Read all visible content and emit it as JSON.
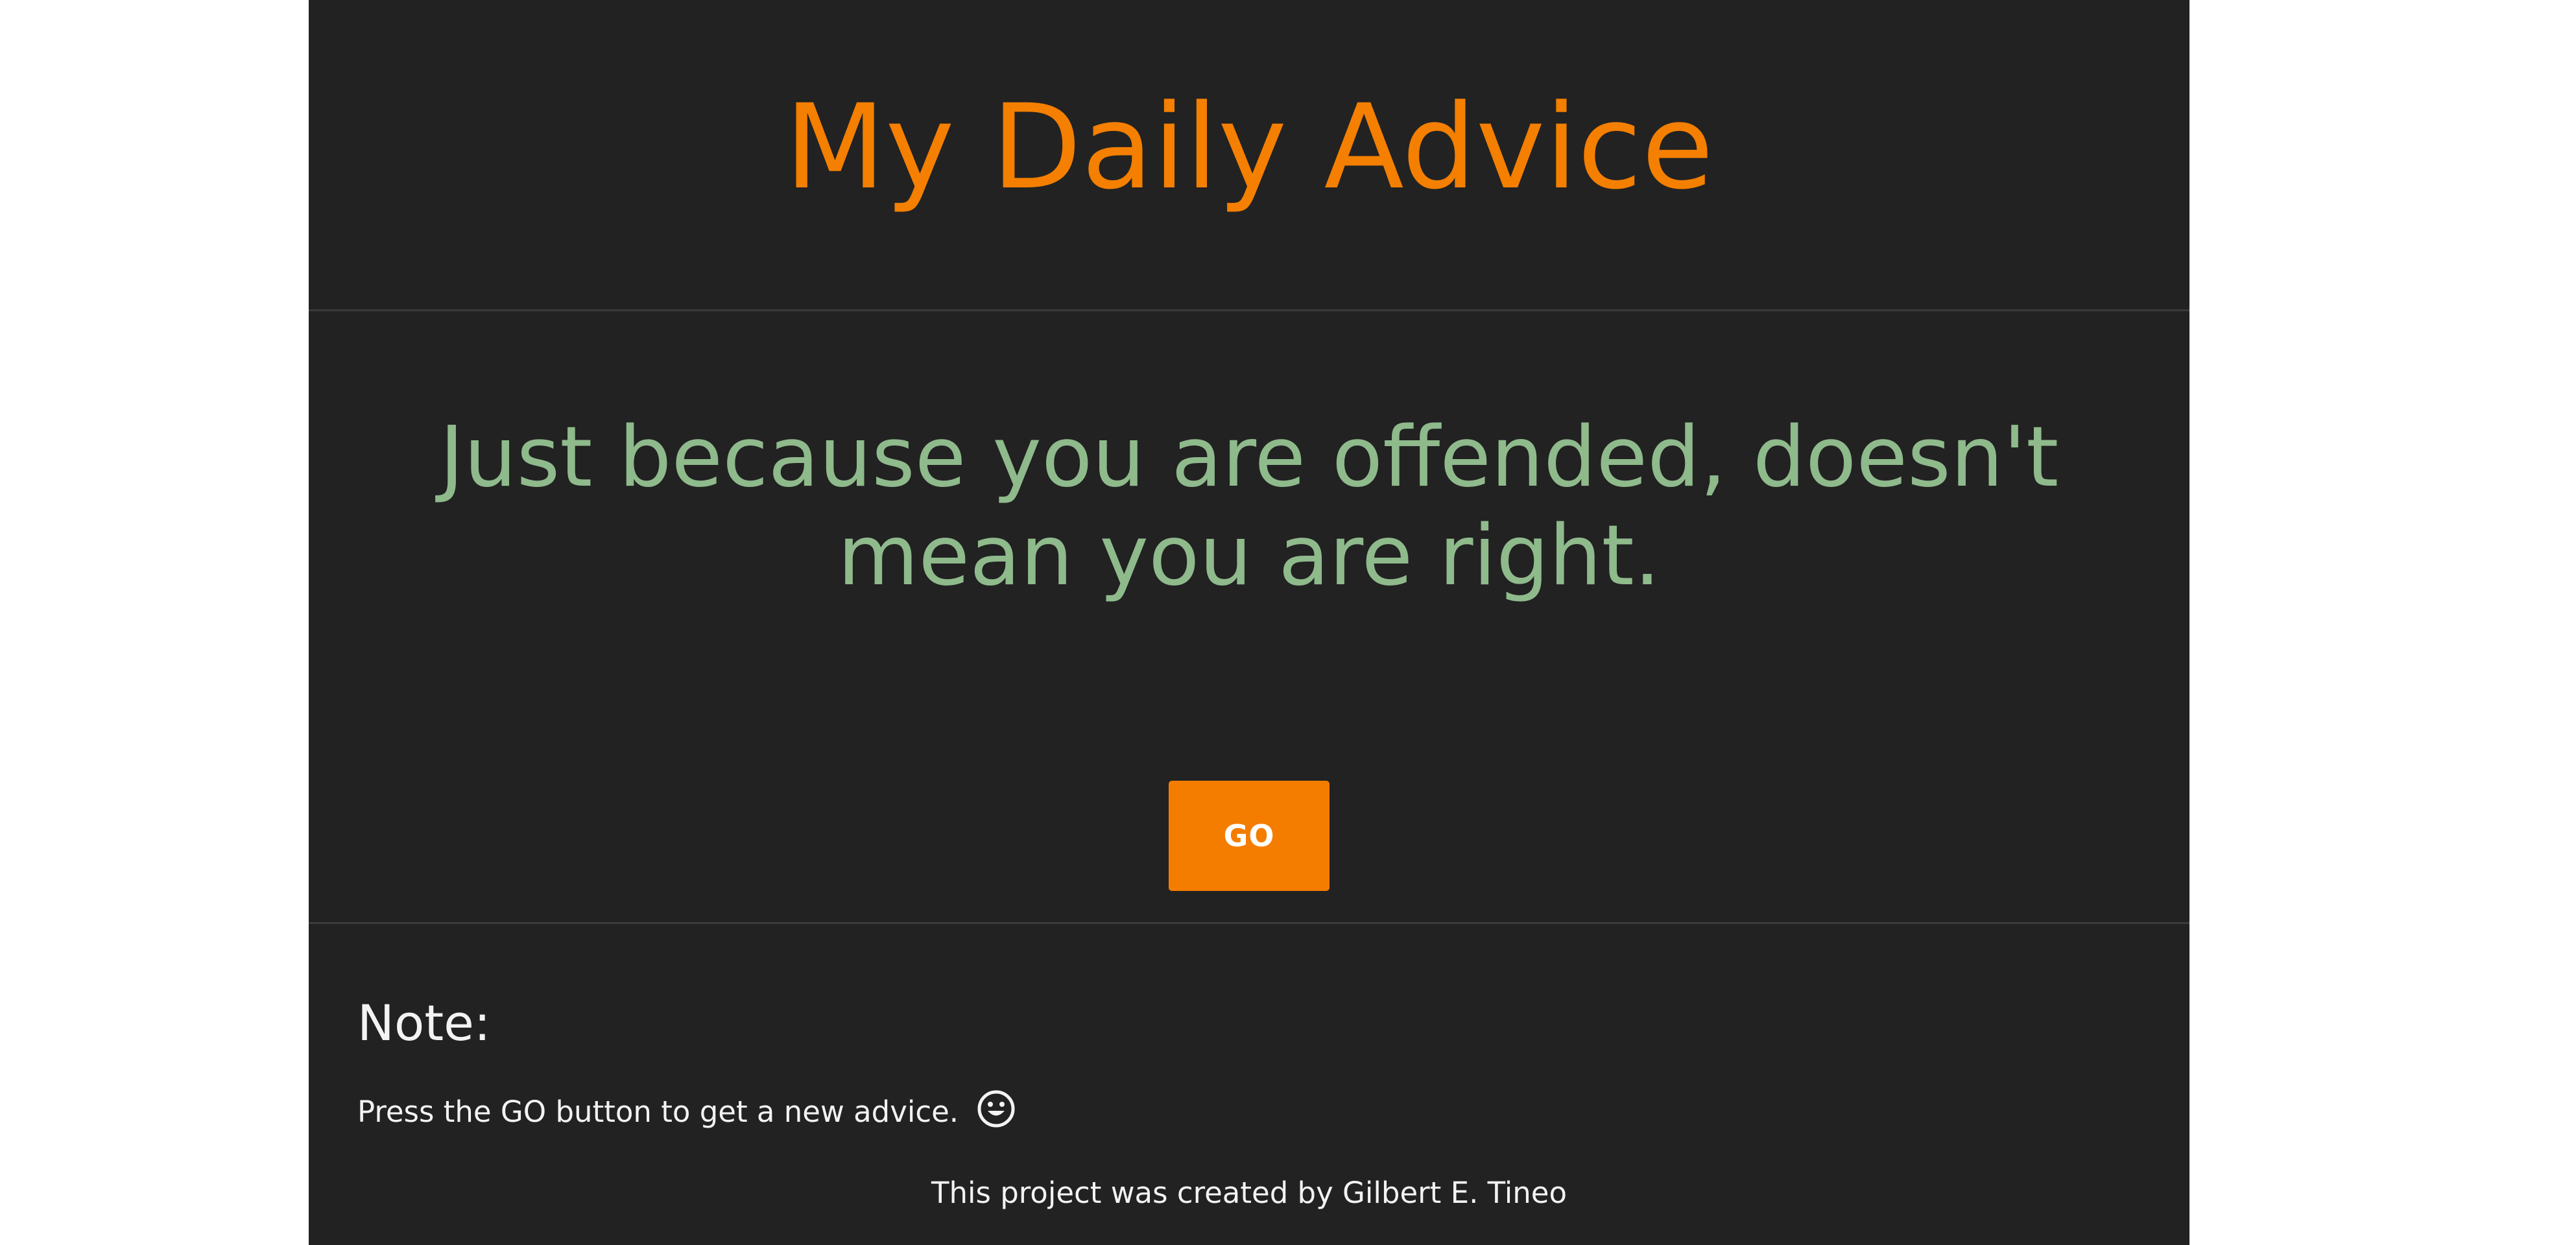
{
  "header": {
    "title": "My Daily Advice"
  },
  "advice": {
    "text": "Just because you are offended, doesn't mean you are right."
  },
  "controls": {
    "go_label": "GO"
  },
  "footer": {
    "note_heading": "Note:",
    "note_text": "Press the GO button to get a new advice.",
    "note_icon": "smiley-face-icon",
    "credit": "This project was created by Gilbert E. Tineo"
  },
  "colors": {
    "background": "#222222",
    "title": "#f47f00",
    "advice": "#8fba8c",
    "button": "#f47d00",
    "text": "#f3f3f3"
  }
}
